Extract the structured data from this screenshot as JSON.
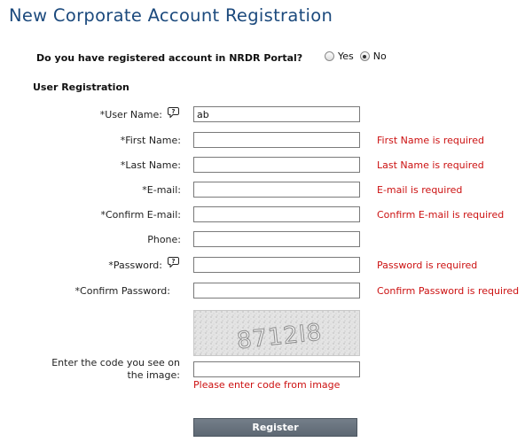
{
  "page_title": "New Corporate Account Registration",
  "registered_question": {
    "text": "Do you have registered account in NRDR Portal?",
    "options": [
      {
        "label": "Yes",
        "checked": false
      },
      {
        "label": "No",
        "checked": true
      }
    ]
  },
  "section_title": "User Registration",
  "form": {
    "user_name": {
      "label": "*User Name:",
      "value": "ab",
      "error": ""
    },
    "first_name": {
      "label": "*First Name:",
      "value": "",
      "error": "First Name is required"
    },
    "last_name": {
      "label": "*Last Name:",
      "value": "",
      "error": "Last Name is required"
    },
    "email": {
      "label": "*E-mail:",
      "value": "",
      "error": "E-mail is required"
    },
    "confirm_email": {
      "label": "*Confirm E-mail:",
      "value": "",
      "error": "Confirm E-mail is required"
    },
    "phone": {
      "label": "Phone:",
      "value": "",
      "error": ""
    },
    "password": {
      "label": "*Password:",
      "value": "",
      "error": "Password is required"
    },
    "confirm_password": {
      "label": "*Confirm Password:",
      "value": "",
      "error": "Confirm Password is required"
    }
  },
  "captcha": {
    "code_image_text": "8712I8",
    "label": "Enter the code you see on the image:",
    "value": "",
    "error": "Please enter code from image"
  },
  "register_button": "Register",
  "colors": {
    "title": "#1c4a7d",
    "error": "#cc1111",
    "button": "#68727d"
  },
  "icons": {
    "help": "help-bubble-icon"
  }
}
